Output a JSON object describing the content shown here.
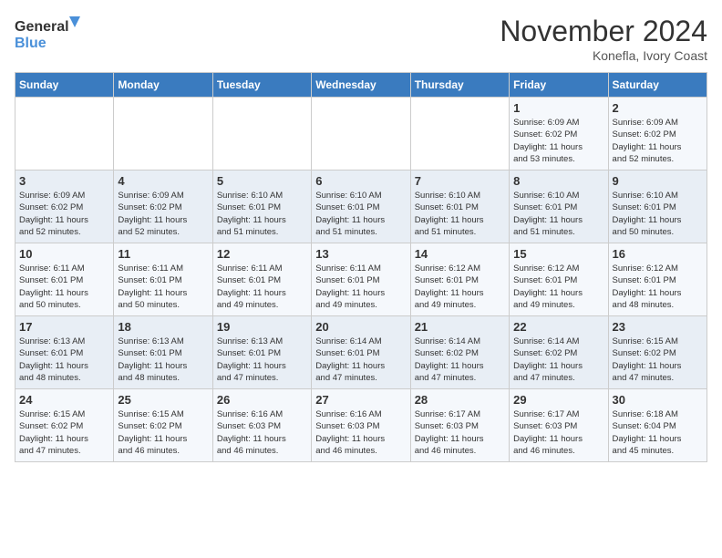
{
  "header": {
    "logo_line1": "General",
    "logo_line2": "Blue",
    "month_title": "November 2024",
    "location": "Konefla, Ivory Coast"
  },
  "days_of_week": [
    "Sunday",
    "Monday",
    "Tuesday",
    "Wednesday",
    "Thursday",
    "Friday",
    "Saturday"
  ],
  "weeks": [
    [
      {
        "day": "",
        "info": ""
      },
      {
        "day": "",
        "info": ""
      },
      {
        "day": "",
        "info": ""
      },
      {
        "day": "",
        "info": ""
      },
      {
        "day": "",
        "info": ""
      },
      {
        "day": "1",
        "info": "Sunrise: 6:09 AM\nSunset: 6:02 PM\nDaylight: 11 hours\nand 53 minutes."
      },
      {
        "day": "2",
        "info": "Sunrise: 6:09 AM\nSunset: 6:02 PM\nDaylight: 11 hours\nand 52 minutes."
      }
    ],
    [
      {
        "day": "3",
        "info": "Sunrise: 6:09 AM\nSunset: 6:02 PM\nDaylight: 11 hours\nand 52 minutes."
      },
      {
        "day": "4",
        "info": "Sunrise: 6:09 AM\nSunset: 6:02 PM\nDaylight: 11 hours\nand 52 minutes."
      },
      {
        "day": "5",
        "info": "Sunrise: 6:10 AM\nSunset: 6:01 PM\nDaylight: 11 hours\nand 51 minutes."
      },
      {
        "day": "6",
        "info": "Sunrise: 6:10 AM\nSunset: 6:01 PM\nDaylight: 11 hours\nand 51 minutes."
      },
      {
        "day": "7",
        "info": "Sunrise: 6:10 AM\nSunset: 6:01 PM\nDaylight: 11 hours\nand 51 minutes."
      },
      {
        "day": "8",
        "info": "Sunrise: 6:10 AM\nSunset: 6:01 PM\nDaylight: 11 hours\nand 51 minutes."
      },
      {
        "day": "9",
        "info": "Sunrise: 6:10 AM\nSunset: 6:01 PM\nDaylight: 11 hours\nand 50 minutes."
      }
    ],
    [
      {
        "day": "10",
        "info": "Sunrise: 6:11 AM\nSunset: 6:01 PM\nDaylight: 11 hours\nand 50 minutes."
      },
      {
        "day": "11",
        "info": "Sunrise: 6:11 AM\nSunset: 6:01 PM\nDaylight: 11 hours\nand 50 minutes."
      },
      {
        "day": "12",
        "info": "Sunrise: 6:11 AM\nSunset: 6:01 PM\nDaylight: 11 hours\nand 49 minutes."
      },
      {
        "day": "13",
        "info": "Sunrise: 6:11 AM\nSunset: 6:01 PM\nDaylight: 11 hours\nand 49 minutes."
      },
      {
        "day": "14",
        "info": "Sunrise: 6:12 AM\nSunset: 6:01 PM\nDaylight: 11 hours\nand 49 minutes."
      },
      {
        "day": "15",
        "info": "Sunrise: 6:12 AM\nSunset: 6:01 PM\nDaylight: 11 hours\nand 49 minutes."
      },
      {
        "day": "16",
        "info": "Sunrise: 6:12 AM\nSunset: 6:01 PM\nDaylight: 11 hours\nand 48 minutes."
      }
    ],
    [
      {
        "day": "17",
        "info": "Sunrise: 6:13 AM\nSunset: 6:01 PM\nDaylight: 11 hours\nand 48 minutes."
      },
      {
        "day": "18",
        "info": "Sunrise: 6:13 AM\nSunset: 6:01 PM\nDaylight: 11 hours\nand 48 minutes."
      },
      {
        "day": "19",
        "info": "Sunrise: 6:13 AM\nSunset: 6:01 PM\nDaylight: 11 hours\nand 47 minutes."
      },
      {
        "day": "20",
        "info": "Sunrise: 6:14 AM\nSunset: 6:01 PM\nDaylight: 11 hours\nand 47 minutes."
      },
      {
        "day": "21",
        "info": "Sunrise: 6:14 AM\nSunset: 6:02 PM\nDaylight: 11 hours\nand 47 minutes."
      },
      {
        "day": "22",
        "info": "Sunrise: 6:14 AM\nSunset: 6:02 PM\nDaylight: 11 hours\nand 47 minutes."
      },
      {
        "day": "23",
        "info": "Sunrise: 6:15 AM\nSunset: 6:02 PM\nDaylight: 11 hours\nand 47 minutes."
      }
    ],
    [
      {
        "day": "24",
        "info": "Sunrise: 6:15 AM\nSunset: 6:02 PM\nDaylight: 11 hours\nand 47 minutes."
      },
      {
        "day": "25",
        "info": "Sunrise: 6:15 AM\nSunset: 6:02 PM\nDaylight: 11 hours\nand 46 minutes."
      },
      {
        "day": "26",
        "info": "Sunrise: 6:16 AM\nSunset: 6:03 PM\nDaylight: 11 hours\nand 46 minutes."
      },
      {
        "day": "27",
        "info": "Sunrise: 6:16 AM\nSunset: 6:03 PM\nDaylight: 11 hours\nand 46 minutes."
      },
      {
        "day": "28",
        "info": "Sunrise: 6:17 AM\nSunset: 6:03 PM\nDaylight: 11 hours\nand 46 minutes."
      },
      {
        "day": "29",
        "info": "Sunrise: 6:17 AM\nSunset: 6:03 PM\nDaylight: 11 hours\nand 46 minutes."
      },
      {
        "day": "30",
        "info": "Sunrise: 6:18 AM\nSunset: 6:04 PM\nDaylight: 11 hours\nand 45 minutes."
      }
    ]
  ]
}
